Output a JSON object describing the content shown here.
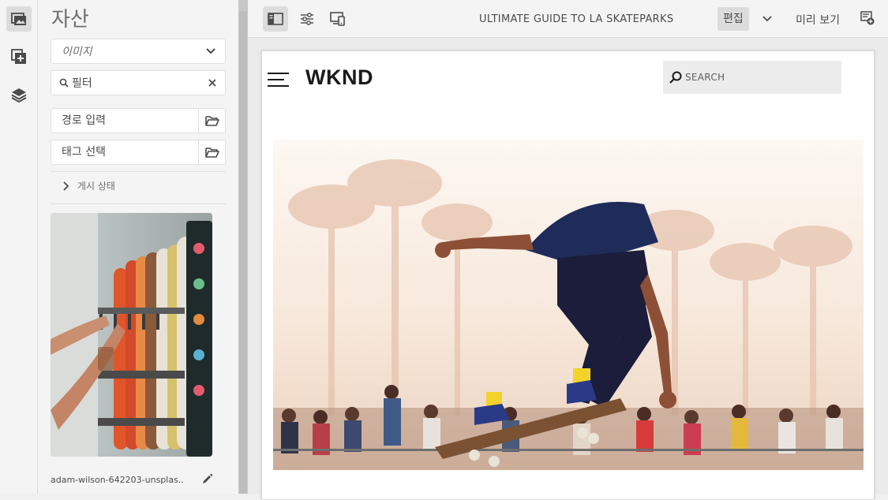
{
  "rail": {
    "items": [
      {
        "name": "assets-finder-icon",
        "active": true
      },
      {
        "name": "components-icon",
        "active": false
      },
      {
        "name": "content-tree-icon",
        "active": false
      }
    ]
  },
  "assets_panel": {
    "title": "자산",
    "type_select": {
      "value": "이미지"
    },
    "filter": {
      "value": "필터"
    },
    "path_field": {
      "placeholder": "경로 입력"
    },
    "tag_field": {
      "placeholder": "태그 선택"
    },
    "publish_status_label": "게시 상태",
    "asset": {
      "filename": "adam-wilson-642203-unsplas..."
    }
  },
  "toolbar": {
    "page_title": "ULTIMATE GUIDE TO LA SKATEPARKS",
    "mode_label": "편집",
    "preview_label": "미리 보기"
  },
  "page": {
    "logo": "WKND",
    "search_placeholder": "SEARCH"
  },
  "colors": {
    "panel_bg": "#f4f4f4",
    "active_bg": "#dcdcdc",
    "splitter": "#c8c8c8",
    "canvas_bg": "#ebebeb"
  }
}
